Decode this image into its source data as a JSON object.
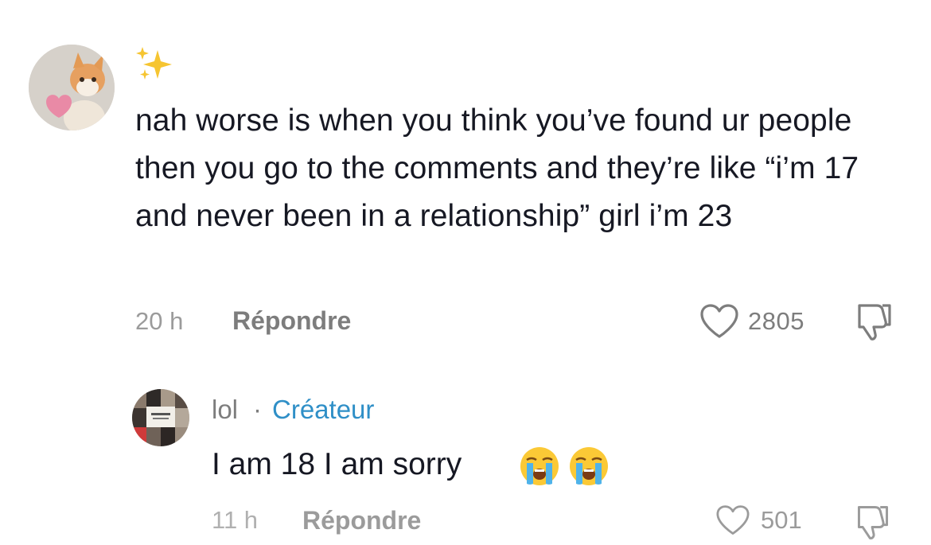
{
  "comment": {
    "author_icon": "sparkles-icon",
    "text": "nah worse is when you think you’ve found ur people then you go to the comments and they’re like “i’m 17 and never been in a relationship” girl i’m 23",
    "time": "20 h",
    "reply_label": "Répondre",
    "like_count": "2805"
  },
  "reply": {
    "username": "lol",
    "separator": "·",
    "badge": "Créateur",
    "text": "I am 18 I am sorry",
    "emojis": [
      "crying-face-emoji",
      "crying-face-emoji"
    ]
  },
  "next_meta": {
    "time": "11 h",
    "reply_label": "Répondre",
    "like_count": "501"
  },
  "colors": {
    "text": "#161823",
    "muted": "#7d7d7d",
    "creator": "#2f8fc7"
  }
}
